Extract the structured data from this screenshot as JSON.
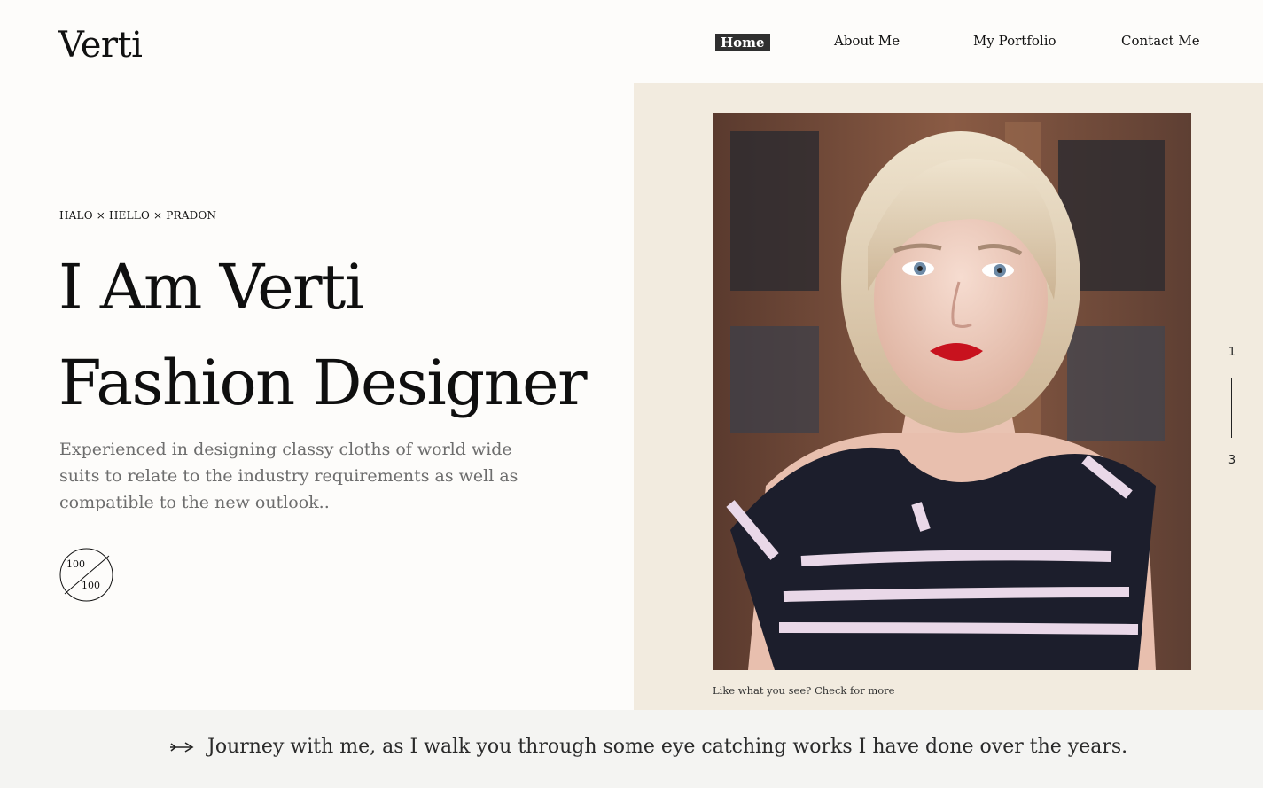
{
  "brand": {
    "name": "Verti"
  },
  "nav": {
    "items": [
      {
        "label": "Home",
        "active": true
      },
      {
        "label": "About Me",
        "active": false
      },
      {
        "label": "My Portfolio",
        "active": false
      },
      {
        "label": "Contact Me",
        "active": false
      }
    ]
  },
  "hero": {
    "tagline": "HALO × HELLO ×  PRADON",
    "headline_line1": "I Am Verti",
    "headline_line2": "Fashion Designer",
    "description": "Experienced in designing classy cloths of world wide suits to relate to the industry requirements as well as compatible to the new outlook..",
    "score_top": "100",
    "score_bottom": "100",
    "photo_caption": "Like what you see? Check for more",
    "slide_current": "1",
    "slide_total": "3"
  },
  "footer_band": {
    "text": "Journey with me, as I walk you through some eye catching works I have done over the years."
  },
  "colors": {
    "page_bg": "#fdfcfa",
    "panel_bg": "#f2ebdf",
    "nav_active_bg": "#2f2f2f",
    "description_text": "#6d6d6d",
    "band_bg": "#f4f4f2"
  }
}
